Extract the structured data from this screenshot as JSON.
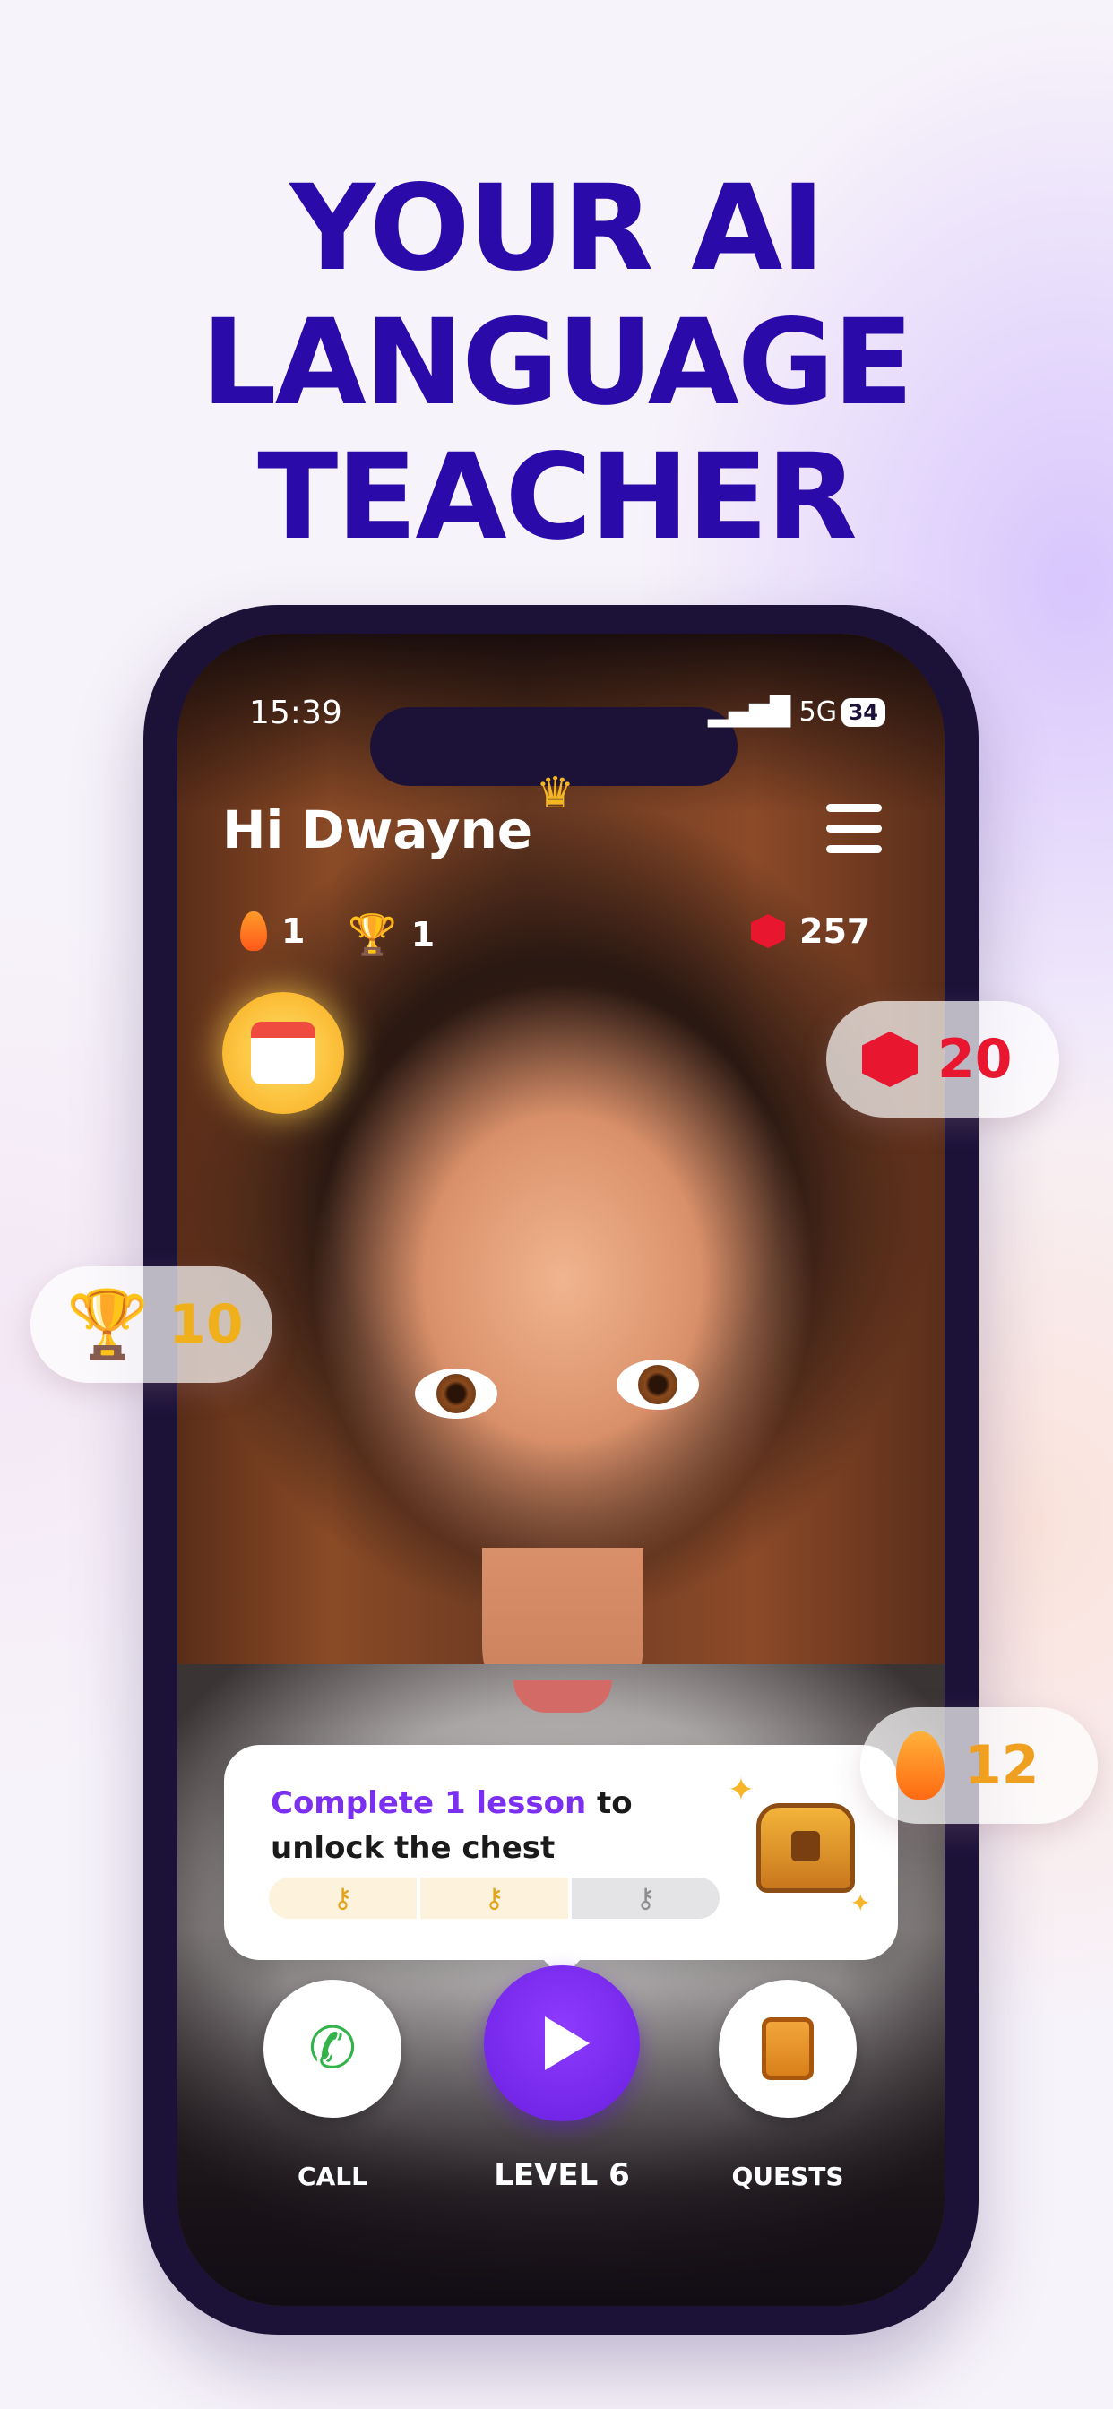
{
  "headline": [
    "YOUR AI",
    "LANGUAGE",
    "TEACHER"
  ],
  "status_bar": {
    "time": "15:39",
    "network": "5G",
    "battery": "34"
  },
  "header": {
    "greeting": "Hi Dwayne"
  },
  "stats": {
    "streak": "1",
    "trophies": "1",
    "gems": "257"
  },
  "lesson_card": {
    "highlight": "Complete 1 lesson",
    "text_after": " to unlock the chest",
    "keys_collected": 2,
    "keys_total": 3
  },
  "nav": {
    "call_label": "CALL",
    "level_label": "LEVEL 6",
    "quests_label": "QUESTS"
  },
  "floating_badges": {
    "gems": "20",
    "trophies": "10",
    "streak": "12"
  },
  "colors": {
    "headline": "#2a0aa8",
    "accent": "#7b2ff0",
    "gem": "#e8162e",
    "gold": "#f0b01c",
    "streak": "#ff6a12"
  }
}
